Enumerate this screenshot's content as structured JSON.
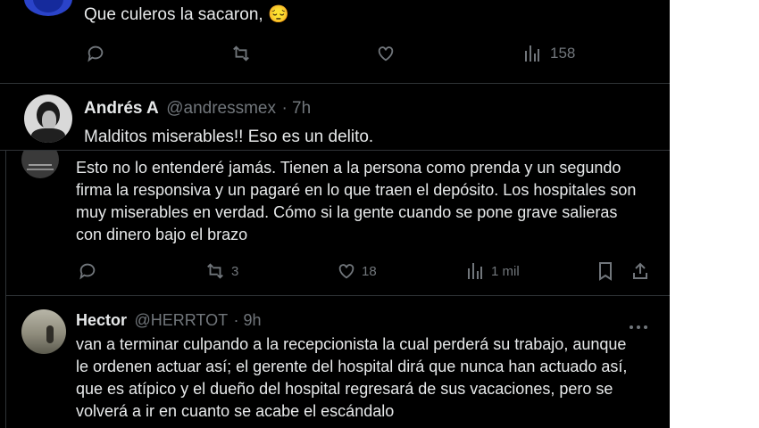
{
  "top_tweet": {
    "text": "Que culeros la sacaron, 😔",
    "views": "158"
  },
  "andres_tweet": {
    "name": "Andrés A",
    "handle": "@andressmex",
    "time": "· 7h",
    "text": "Malditos miserables!! Eso es un delito."
  },
  "middle_tweet": {
    "text": "Esto no lo entenderé jamás. Tienen a la persona como prenda y un segundo firma la responsiva y un pagaré en lo que traen el depósito. Los hospitales son muy miserables en verdad. Cómo si la gente cuando se pone grave salieras con dinero bajo el brazo",
    "retweets": "3",
    "likes": "18",
    "views": "1 mil"
  },
  "hector_tweet": {
    "name": "Hector",
    "handle": "@HERRTOT",
    "time": "· 9h",
    "text": "van a terminar culpando a la recepcionista la cual perderá su trabajo, aunque le ordenen actuar así; el gerente del hospital dirá que nunca han actuado así, que es atípico y el dueño del hospital regresará de sus vacaciones, pero se volverá a ir en cuanto se acabe el escándalo"
  },
  "colors": {
    "background": "#000000",
    "text": "#e7e9ea",
    "muted": "#71767b",
    "border": "#2f3336"
  }
}
